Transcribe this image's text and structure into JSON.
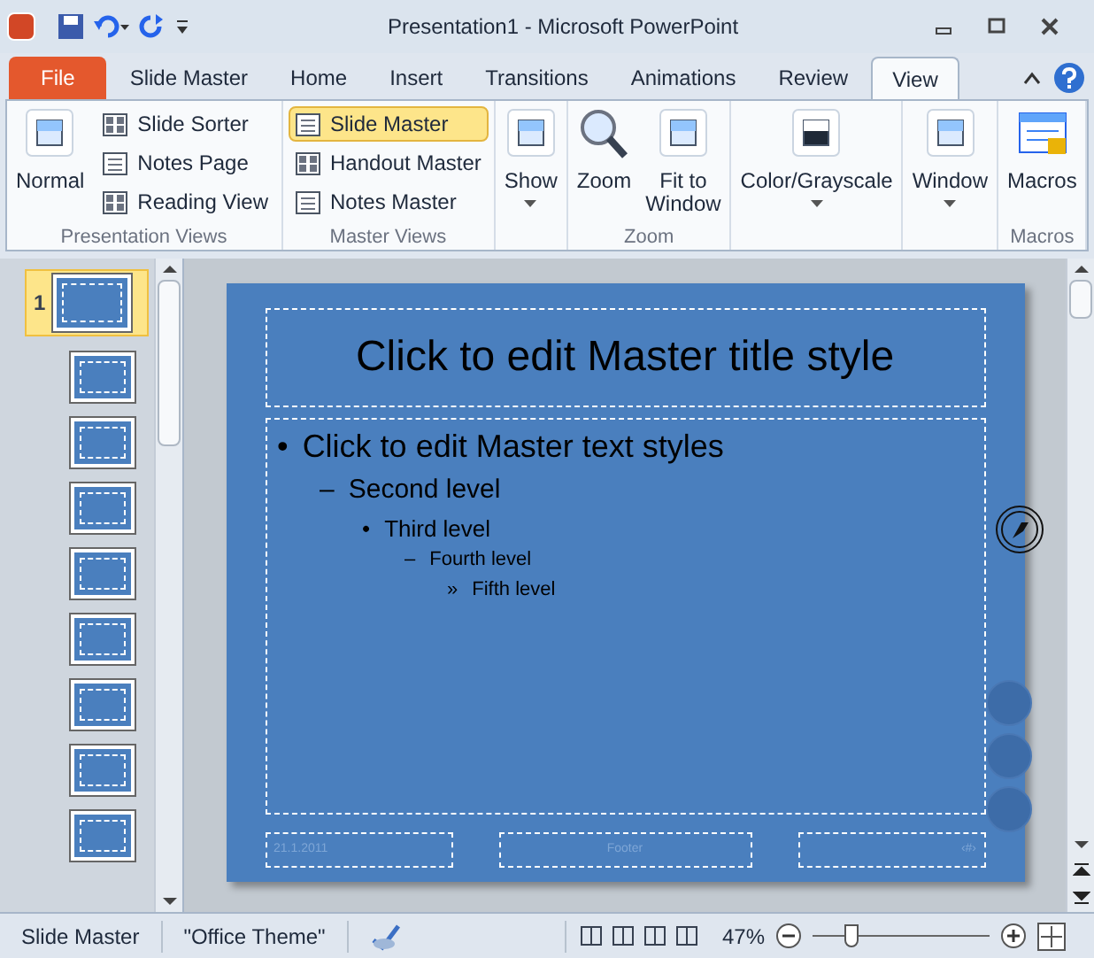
{
  "window": {
    "title": "Presentation1  -  Microsoft PowerPoint"
  },
  "tabs": [
    {
      "label": "File",
      "kind": "file",
      "selected": false
    },
    {
      "label": "Slide Master",
      "kind": "tab",
      "selected": false
    },
    {
      "label": "Home",
      "kind": "tab",
      "selected": false
    },
    {
      "label": "Insert",
      "kind": "tab",
      "selected": false
    },
    {
      "label": "Transitions",
      "kind": "tab",
      "selected": false
    },
    {
      "label": "Animations",
      "kind": "tab",
      "selected": false
    },
    {
      "label": "Review",
      "kind": "tab",
      "selected": false
    },
    {
      "label": "View",
      "kind": "tab",
      "selected": true
    }
  ],
  "ribbon": {
    "groups": [
      {
        "label": "Presentation Views",
        "large": [
          {
            "label": "Normal"
          }
        ],
        "small": [
          {
            "label": "Slide Sorter",
            "selected": false
          },
          {
            "label": "Notes Page",
            "selected": false
          },
          {
            "label": "Reading View",
            "selected": false
          }
        ]
      },
      {
        "label": "Master Views",
        "small": [
          {
            "label": "Slide Master",
            "selected": true
          },
          {
            "label": "Handout Master",
            "selected": false
          },
          {
            "label": "Notes Master",
            "selected": false
          }
        ]
      },
      {
        "large": [
          {
            "label": "Show",
            "dropdown": true
          }
        ]
      },
      {
        "label": "Zoom",
        "large": [
          {
            "label": "Zoom"
          },
          {
            "label": "Fit to Window"
          }
        ]
      },
      {
        "large": [
          {
            "label": "Color/Grayscale",
            "dropdown": true
          }
        ]
      },
      {
        "large": [
          {
            "label": "Window",
            "dropdown": true
          }
        ]
      },
      {
        "label": "Macros",
        "large": [
          {
            "label": "Macros"
          }
        ]
      }
    ]
  },
  "slides": [
    {
      "number": "1",
      "selected": true
    },
    {
      "selected": false
    },
    {
      "selected": false
    },
    {
      "selected": false
    },
    {
      "selected": false
    },
    {
      "selected": false
    },
    {
      "selected": false
    },
    {
      "selected": false
    },
    {
      "selected": false
    }
  ],
  "slide": {
    "title": "Click to edit Master title style",
    "outline": [
      {
        "bullet": "•",
        "text": "Click to edit Master text styles",
        "children": [
          {
            "bullet": "–",
            "text": "Second level",
            "children": [
              {
                "bullet": "•",
                "text": "Third level",
                "children": [
                  {
                    "bullet": "–",
                    "text": "Fourth level",
                    "children": [
                      {
                        "bullet": "»",
                        "text": "Fifth level"
                      }
                    ]
                  }
                ]
              }
            ]
          }
        ]
      }
    ],
    "footer": {
      "date": "21.1.2011",
      "center": "Footer",
      "page": "‹#›"
    }
  },
  "status_bar": {
    "items": [
      "Slide Master",
      "\"Office Theme\""
    ],
    "zoom": "47%",
    "zoom_level": {
      "level": 0.22
    }
  }
}
